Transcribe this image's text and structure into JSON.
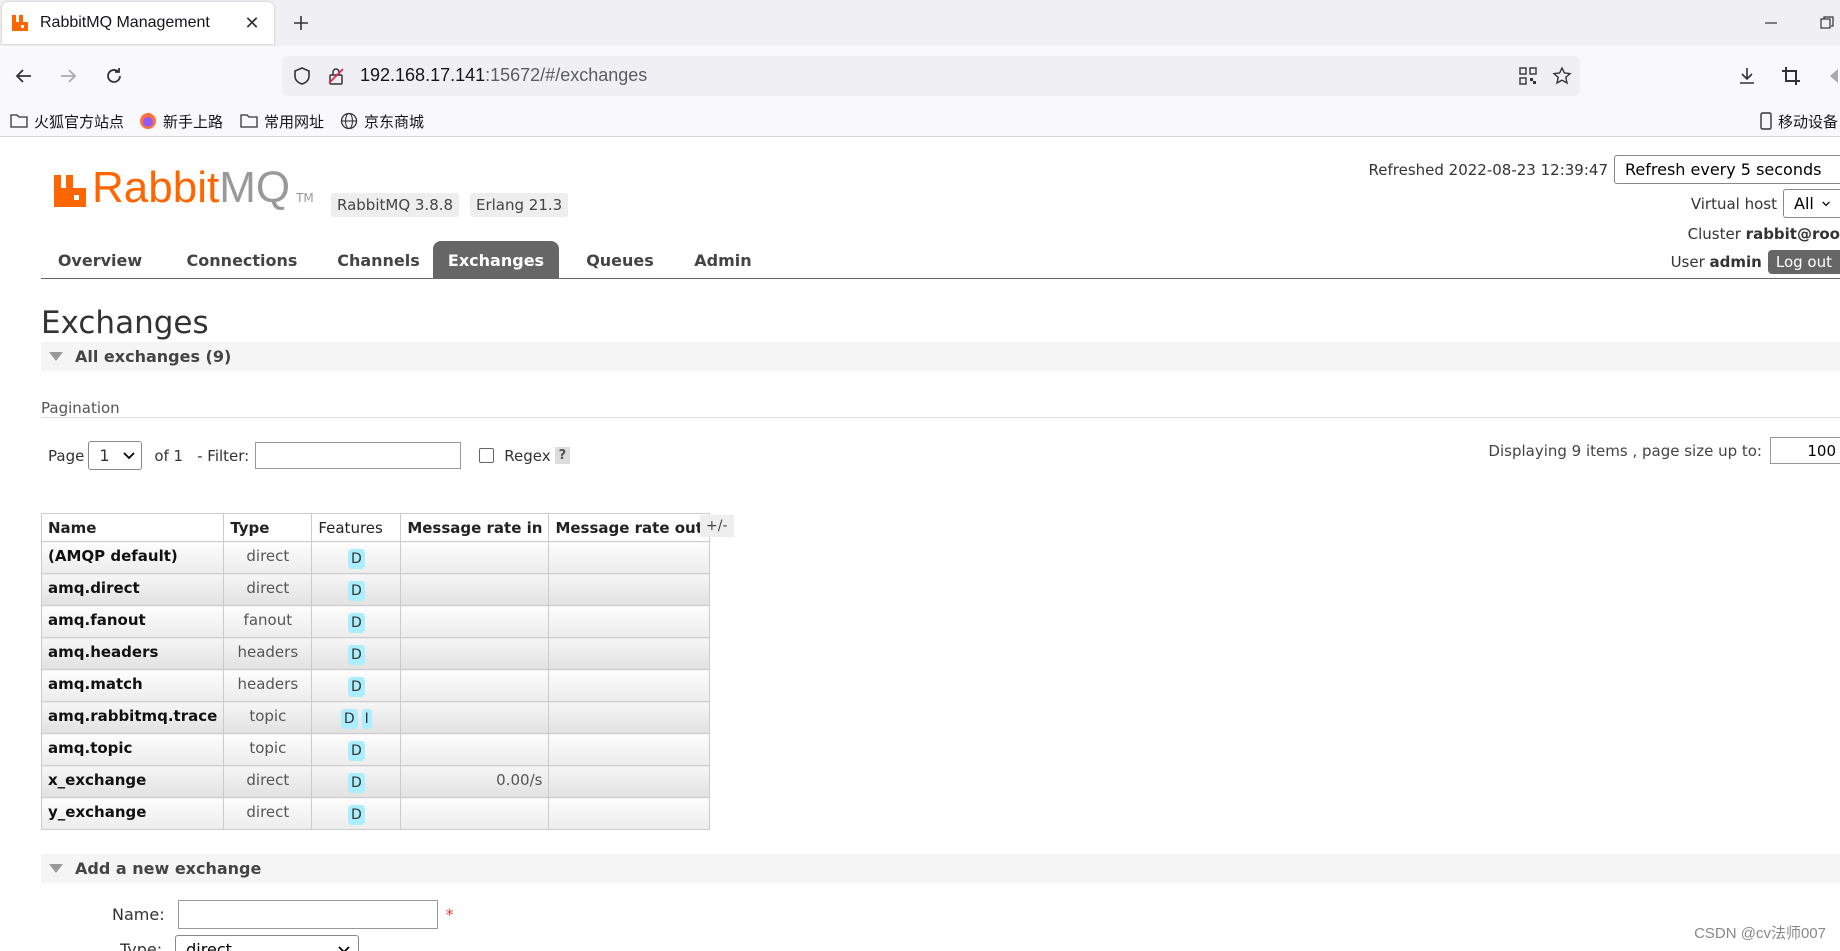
{
  "browser": {
    "tab_title": "RabbitMQ Management",
    "url_host": "192.168.17.141",
    "url_rest": ":15672/#/exchanges",
    "bookmarks": [
      "火狐官方站点",
      "新手上路",
      "常用网址",
      "京东商城"
    ],
    "mobile_bookmarks": "移动设备"
  },
  "header": {
    "logo_rabbit": "Rabbit",
    "logo_mq": "MQ",
    "logo_tm": "TM",
    "version_rabbitmq": "RabbitMQ 3.8.8",
    "version_erlang": "Erlang 21.3",
    "refreshed_label": "Refreshed 2022-08-23 12:39:47",
    "refresh_select": "Refresh every 5 seconds",
    "virtual_host_label": "Virtual host",
    "virtual_host_value": "All",
    "cluster_label": "Cluster",
    "cluster_value": "rabbit@roo",
    "user_label": "User",
    "user_value": "admin",
    "logout_label": "Log out"
  },
  "nav_tabs": [
    "Overview",
    "Connections",
    "Channels",
    "Exchanges",
    "Queues",
    "Admin"
  ],
  "active_tab": "Exchanges",
  "page_title": "Exchanges",
  "all_exchanges_section": "All exchanges (9)",
  "pagination": {
    "label": "Pagination",
    "page_label": "Page",
    "page_value": "1",
    "of_label": "of 1",
    "filter_label": "- Filter:",
    "regex_label": "Regex",
    "help_label": "?",
    "display_label": "Displaying 9 items , page size up to:",
    "page_size": "100"
  },
  "table": {
    "headers": [
      "Name",
      "Type",
      "Features",
      "Message rate in",
      "Message rate out"
    ],
    "toggle_columns": "+/-",
    "rows": [
      {
        "name": "(AMQP default)",
        "type": "direct",
        "features": [
          "D"
        ],
        "rate_in": "",
        "rate_out": ""
      },
      {
        "name": "amq.direct",
        "type": "direct",
        "features": [
          "D"
        ],
        "rate_in": "",
        "rate_out": ""
      },
      {
        "name": "amq.fanout",
        "type": "fanout",
        "features": [
          "D"
        ],
        "rate_in": "",
        "rate_out": ""
      },
      {
        "name": "amq.headers",
        "type": "headers",
        "features": [
          "D"
        ],
        "rate_in": "",
        "rate_out": ""
      },
      {
        "name": "amq.match",
        "type": "headers",
        "features": [
          "D"
        ],
        "rate_in": "",
        "rate_out": ""
      },
      {
        "name": "amq.rabbitmq.trace",
        "type": "topic",
        "features": [
          "D",
          "I"
        ],
        "rate_in": "",
        "rate_out": ""
      },
      {
        "name": "amq.topic",
        "type": "topic",
        "features": [
          "D"
        ],
        "rate_in": "",
        "rate_out": ""
      },
      {
        "name": "x_exchange",
        "type": "direct",
        "features": [
          "D"
        ],
        "rate_in": "0.00/s",
        "rate_out": ""
      },
      {
        "name": "y_exchange",
        "type": "direct",
        "features": [
          "D"
        ],
        "rate_in": "",
        "rate_out": ""
      }
    ]
  },
  "add_exchange": {
    "section": "Add a new exchange",
    "name_label": "Name:",
    "required_mark": "*",
    "type_label": "Type:",
    "type_value": "direct"
  },
  "watermark": "CSDN @cv法师007",
  "colors": {
    "brand_orange": "#ff6600",
    "tab_active": "#666666",
    "feature_badge": "#aaeeff"
  }
}
